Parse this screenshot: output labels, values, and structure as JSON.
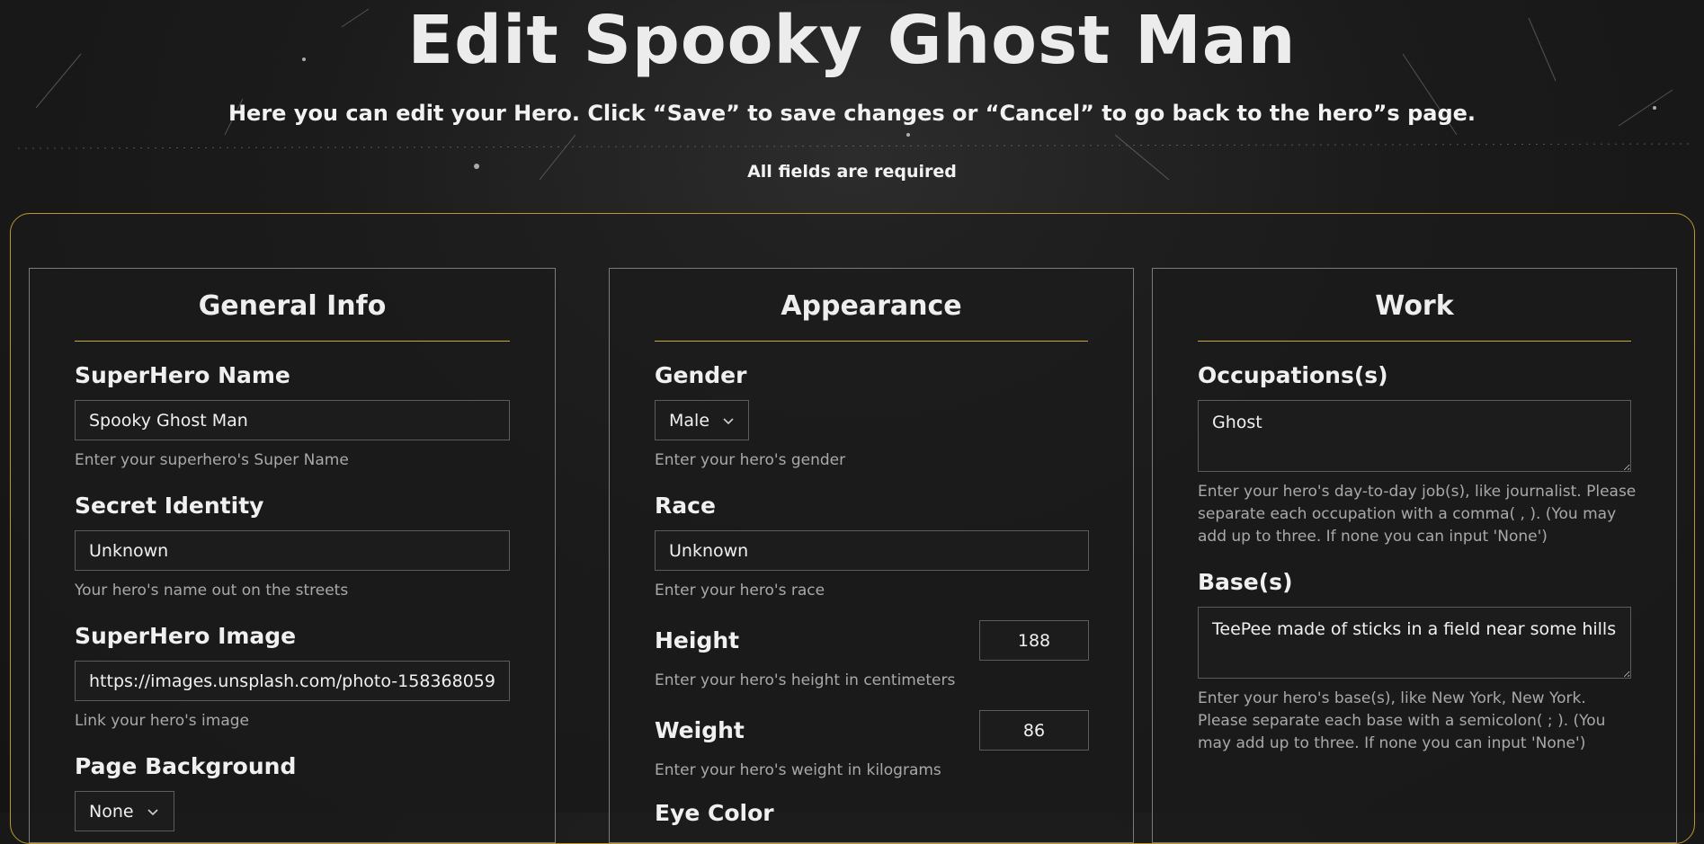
{
  "page": {
    "title": "Edit Spooky Ghost Man",
    "subtitle": "Here you can edit your Hero. Click “Save” to save changes or “Cancel” to go back to the hero”s page.",
    "required_note": "All fields are required"
  },
  "general": {
    "heading": "General Info",
    "name": {
      "label": "SuperHero Name",
      "value": "Spooky Ghost Man",
      "hint": "Enter your superhero's Super Name"
    },
    "identity": {
      "label": "Secret Identity",
      "value": "Unknown",
      "hint": "Your hero's name out on the streets"
    },
    "image": {
      "label": "SuperHero Image",
      "value": "https://images.unsplash.com/photo-158368059",
      "hint": "Link your hero's image"
    },
    "background": {
      "label": "Page Background",
      "value": "None"
    }
  },
  "appearance": {
    "heading": "Appearance",
    "gender": {
      "label": "Gender",
      "value": "Male",
      "hint": "Enter your hero's gender"
    },
    "race": {
      "label": "Race",
      "value": "Unknown",
      "hint": "Enter your hero's race"
    },
    "height": {
      "label": "Height",
      "value": "188",
      "hint": "Enter your hero's height in centimeters"
    },
    "weight": {
      "label": "Weight",
      "value": "86",
      "hint": "Enter your hero's weight in kilograms"
    },
    "eye_color": {
      "label": "Eye Color"
    }
  },
  "work": {
    "heading": "Work",
    "occupations": {
      "label": "Occupations(s)",
      "value": "Ghost",
      "hint": "Enter your hero's day-to-day job(s), like journalist. Please separate each occupation with a comma( , ). (You may add up to three. If none you can input 'None')"
    },
    "bases": {
      "label": "Base(s)",
      "value": "TeePee made of sticks in a field near some hills",
      "hint": "Enter your hero's base(s), like New York, New York. Please separate each base with a semicolon( ; ). (You may add up to three. If none you can input 'None')"
    }
  },
  "colors": {
    "accent": "#c9a640",
    "panel_border": "#b9962e",
    "background": "#1b1b1b"
  },
  "icons": {
    "select_arrow": "chevron-down-icon"
  }
}
